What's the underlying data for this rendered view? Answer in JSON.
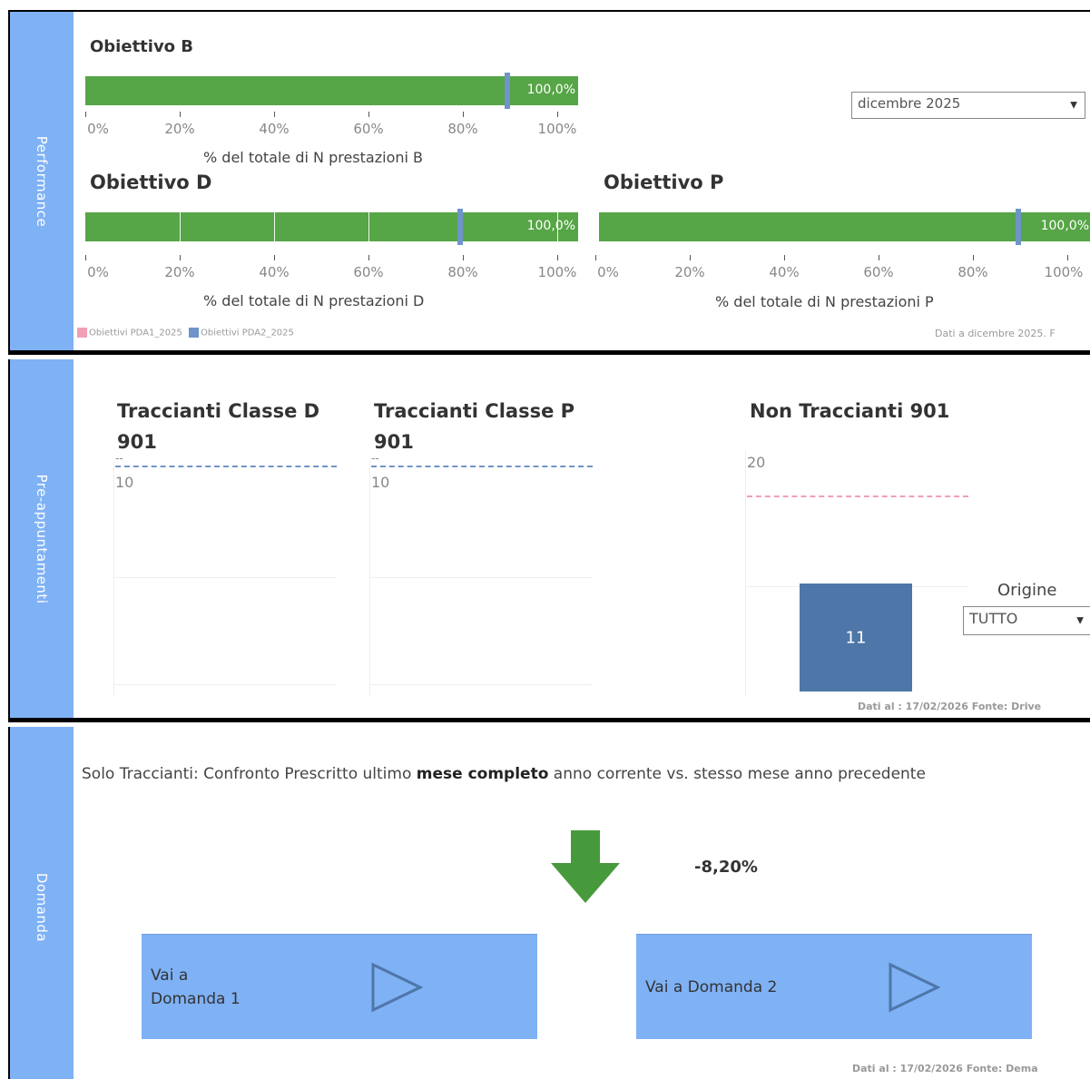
{
  "performance": {
    "tab_label": "Performance",
    "obiettivo_b": {
      "title": "Obiettivo B",
      "value_label": "100,0%",
      "axis_title": "% del totale di N prestazioni B"
    },
    "obiettivo_d": {
      "title": "Obiettivo D",
      "value_label": "100,0%",
      "axis_title": "% del totale di N prestazioni D"
    },
    "obiettivo_p": {
      "title": "Obiettivo P",
      "value_label": "100,0%",
      "axis_title": "% del totale di N prestazioni P"
    },
    "ticks": [
      "0%",
      "20%",
      "40%",
      "60%",
      "80%",
      "100%"
    ],
    "period_dropdown": {
      "value": "dicembre 2025"
    },
    "legend": {
      "item1": "Obiettivi PDA1_2025",
      "item2": "Obiettivi PDA2_2025"
    },
    "source": "Dati a dicembre 2025. F"
  },
  "preappuntamenti": {
    "tab_label": "Pre-appuntamenti",
    "classe_d": {
      "title_line1": "Traccianti Classe D",
      "title_line2": "901",
      "target_label": "--",
      "y_label": "10"
    },
    "classe_p": {
      "title_line1": "Traccianti Classe P",
      "title_line2": "901",
      "target_label": "--",
      "y_label": "10"
    },
    "non_traccianti": {
      "title": "Non Traccianti 901",
      "y_label": "20",
      "bar_value": "11"
    },
    "origine": {
      "label": "Origine",
      "value": "TUTTO"
    },
    "source": "Dati al : 17/02/2026 Fonte: Drive"
  },
  "domanda": {
    "tab_label": "Domanda",
    "description_pre": "Solo Traccianti: Confronto Prescritto ultimo ",
    "description_bold": "mese completo",
    "description_post": " anno corrente vs. stesso mese anno precedente",
    "delta": "-8,20%",
    "button1": {
      "line1": "Vai a",
      "line2": "Domanda 1"
    },
    "button2": {
      "label": "Vai a Domanda 2"
    },
    "source": "Dati al : 17/02/2026 Fonte: Dema"
  },
  "chart_data": [
    {
      "type": "bar",
      "title": "Obiettivo B",
      "xlabel": "% del totale di N prestazioni B",
      "xlim": [
        0,
        100
      ],
      "values": [
        100.0
      ],
      "target": 90,
      "data_label": "100,0%"
    },
    {
      "type": "bar",
      "title": "Obiettivo D",
      "xlabel": "% del totale di N prestazioni D",
      "xlim": [
        0,
        100
      ],
      "values": [
        100.0
      ],
      "target": 80,
      "data_label": "100,0%"
    },
    {
      "type": "bar",
      "title": "Obiettivo P",
      "xlabel": "% del totale di N prestazioni P",
      "xlim": [
        0,
        100
      ],
      "values": [
        100.0
      ],
      "target": 90,
      "data_label": "100,0%"
    },
    {
      "type": "bar",
      "title": "Non Traccianti 901",
      "values": [
        11
      ],
      "target": 20,
      "ylim": [
        0,
        22
      ]
    }
  ],
  "colors": {
    "tab": "#7fb1f5",
    "bar_green": "#56a546",
    "target_blue": "#6f94c9",
    "bar_blue": "#4e76a8",
    "arrow_green": "#479a3b",
    "legend_pink": "#f0a0b4"
  }
}
